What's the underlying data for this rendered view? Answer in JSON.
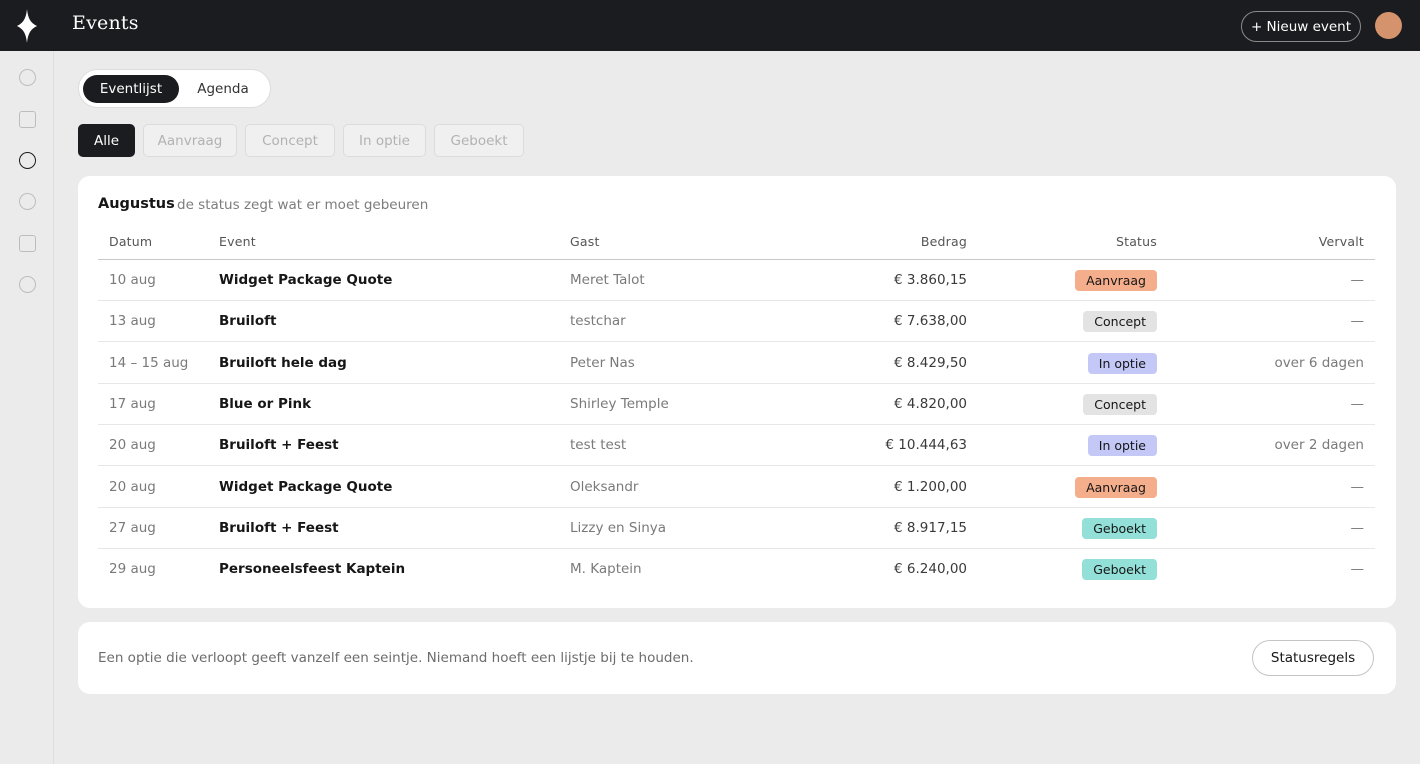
{
  "header": {
    "title": "Events",
    "new_event_label": "+ Nieuw event"
  },
  "sidebar": {
    "logo_icon": "diamond-star-logo",
    "items": [
      {
        "icon": "circle-icon",
        "active": false
      },
      {
        "icon": "square-icon",
        "active": false
      },
      {
        "icon": "circle-icon",
        "active": true
      },
      {
        "icon": "circle-icon",
        "active": false
      },
      {
        "icon": "square-icon",
        "active": false
      },
      {
        "icon": "circle-icon",
        "active": false
      }
    ]
  },
  "view_tabs": [
    {
      "label": "Eventlijst",
      "active": true
    },
    {
      "label": "Agenda",
      "active": false
    }
  ],
  "filters": [
    {
      "label": "Alle",
      "active": true
    },
    {
      "label": "Aanvraag",
      "active": false
    },
    {
      "label": "Concept",
      "active": false
    },
    {
      "label": "In optie",
      "active": false
    },
    {
      "label": "Geboekt",
      "active": false
    }
  ],
  "table": {
    "month": "Augustus",
    "subtitle": "de status zegt wat er moet gebeuren",
    "columns": [
      "Datum",
      "Event",
      "Gast",
      "Bedrag",
      "Status",
      "Vervalt"
    ],
    "rows": [
      {
        "date": "10 aug",
        "event": "Widget Package Quote",
        "guest": "Meret Talot",
        "amount": "€ 3.860,15",
        "status": "Aanvraag",
        "expires": "—"
      },
      {
        "date": "13 aug",
        "event": "Bruiloft",
        "guest": "testchar",
        "amount": "€ 7.638,00",
        "status": "Concept",
        "expires": "—"
      },
      {
        "date": "14 – 15 aug",
        "event": "Bruiloft hele dag",
        "guest": "Peter Nas",
        "amount": "€ 8.429,50",
        "status": "In optie",
        "expires": "over 6 dagen"
      },
      {
        "date": "17 aug",
        "event": "Blue or Pink",
        "guest": "Shirley Temple",
        "amount": "€ 4.820,00",
        "status": "Concept",
        "expires": "—"
      },
      {
        "date": "20 aug",
        "event": "Bruiloft + Feest",
        "guest": "test test",
        "amount": "€ 10.444,63",
        "status": "In optie",
        "expires": "over 2 dagen"
      },
      {
        "date": "20 aug",
        "event": "Widget Package Quote",
        "guest": "Oleksandr",
        "amount": "€ 1.200,00",
        "status": "Aanvraag",
        "expires": "—"
      },
      {
        "date": "27 aug",
        "event": "Bruiloft + Feest",
        "guest": "Lizzy en Sinya",
        "amount": "€ 8.917,15",
        "status": "Geboekt",
        "expires": "—"
      },
      {
        "date": "29 aug",
        "event": "Personeelsfeest Kaptein",
        "guest": "M. Kaptein",
        "amount": "€ 6.240,00",
        "status": "Geboekt",
        "expires": "—"
      }
    ]
  },
  "status_colors": {
    "Aanvraag": "#f5ae8c",
    "Concept": "#e3e3e3",
    "In optie": "#c4c8f7",
    "Geboekt": "#93e0d9"
  },
  "footer": {
    "text": "Een optie die verloopt geeft vanzelf een seintje. Niemand hoeft een lijstje bij te houden.",
    "button_label": "Statusregels"
  }
}
